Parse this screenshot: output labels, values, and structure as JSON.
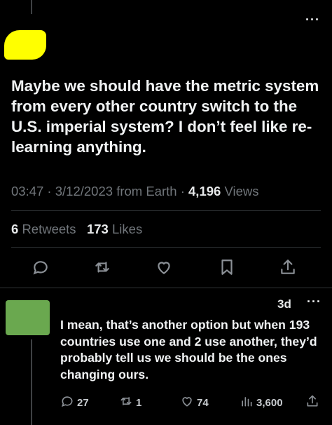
{
  "post": {
    "text": "Maybe we should have the metric system from every other country switch to the U.S. imperial system?  I don’t feel like re-learning anything.",
    "time": "03:47",
    "date": "3/12/2023",
    "source": "from Earth",
    "views_count": "4,196",
    "views_label": "Views",
    "retweets_count": "6",
    "retweets_label": "Retweets",
    "likes_count": "173",
    "likes_label": "Likes",
    "more_label": "···",
    "sep1": " · ",
    "sep2": " · "
  },
  "actions": [
    {
      "icon": "reply-icon"
    },
    {
      "icon": "retweet-icon"
    },
    {
      "icon": "like-icon"
    },
    {
      "icon": "bookmark-icon"
    },
    {
      "icon": "share-icon"
    }
  ],
  "reply": {
    "age": "3d",
    "more_label": "···",
    "text": "I mean, that’s another option but when 193 countries use one and 2 use another, they’d probably tell us we should be the ones changing ours.",
    "replies": "27",
    "retweets": "1",
    "likes": "74",
    "views": "3,600"
  },
  "colors": {
    "background": "#000000",
    "muted": "#71767b",
    "text": "#e7e9ea",
    "redact_yellow": "#ffff00",
    "redact_green": "#6aa84f"
  }
}
